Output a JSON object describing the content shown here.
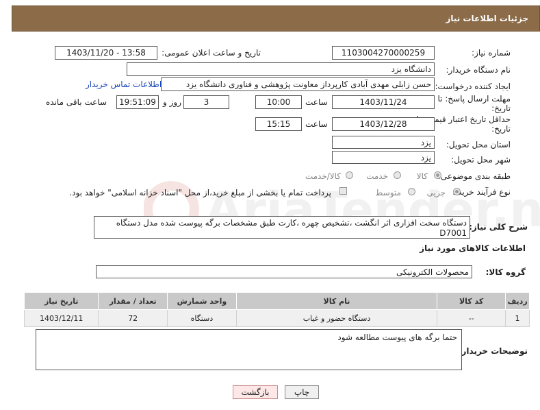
{
  "header": {
    "title": "جزئیات اطلاعات نیاز"
  },
  "fields": {
    "need_number_label": "شماره نیاز:",
    "need_number": "1103004270000259",
    "announce_label": "تاریخ و ساعت اعلان عمومی:",
    "announce_value": "1403/11/20 - 13:58",
    "buyer_label": "نام دستگاه خریدار:",
    "buyer_value": "دانشگاه یزد",
    "creator_label": "ایجاد کننده درخواست:",
    "creator_value": "حسن زابلی مهدی آبادی کارپرداز معاونت پژوهشی و فناوری دانشگاه یزد",
    "contact_link": "اطلاعات تماس خریدار",
    "deadline_label_1": "مهلت ارسال پاسخ: تا",
    "deadline_label_2": "تاریخ:",
    "deadline_date": "1403/11/24",
    "time_label": "ساعت",
    "deadline_time": "10:00",
    "days_value": "3",
    "days_label": "روز و",
    "remaining_time": "19:51:09",
    "remaining_label": "ساعت باقی مانده",
    "validity_label_1": "حداقل تاریخ اعتبار قیمت: تا",
    "validity_label_2": "تاریخ:",
    "validity_date": "1403/12/28",
    "validity_time": "15:15",
    "province_label": "استان محل تحویل:",
    "province_value": "یزد",
    "city_label": "شهر محل تحویل:",
    "city_value": "یزد",
    "category_label": "طبقه بندی موضوعی:",
    "category_options": [
      "کالا",
      "خدمت",
      "کالا/خدمت"
    ],
    "process_label": "نوع فرآیند خرید :",
    "process_options": [
      "جزیی",
      "متوسط"
    ],
    "payment_note": "پرداخت تمام یا بخشی از مبلغ خرید،از محل \"اسناد خزانه اسلامی\" خواهد بود."
  },
  "description": {
    "label": "شرح کلی نیاز:",
    "text": "دستگاه سخت افزاری اثر انگشت ،تشخیص چهره ،کارت طبق مشخصات برگه پیوست شده مدل دستگاه D7001"
  },
  "goods_section": {
    "title": "اطلاعات کالاهای مورد نیاز",
    "group_label": "گروه کالا:",
    "group_value": "محصولات الکترونیکی"
  },
  "table": {
    "headers": [
      "ردیف",
      "کد کالا",
      "نام کالا",
      "واحد شمارش",
      "تعداد / مقدار",
      "تاریخ نیاز"
    ],
    "rows": [
      [
        "1",
        "--",
        "دستگاه حضور و غیاب",
        "دستگاه",
        "72",
        "1403/12/11"
      ]
    ]
  },
  "notes": {
    "label": "توضیحات خریدار:",
    "text": "حتما برگه های پیوست مطالعه شود"
  },
  "buttons": {
    "print": "چاپ",
    "back": "بازگشت"
  },
  "watermark": {
    "text": "AriaTender.neT"
  }
}
